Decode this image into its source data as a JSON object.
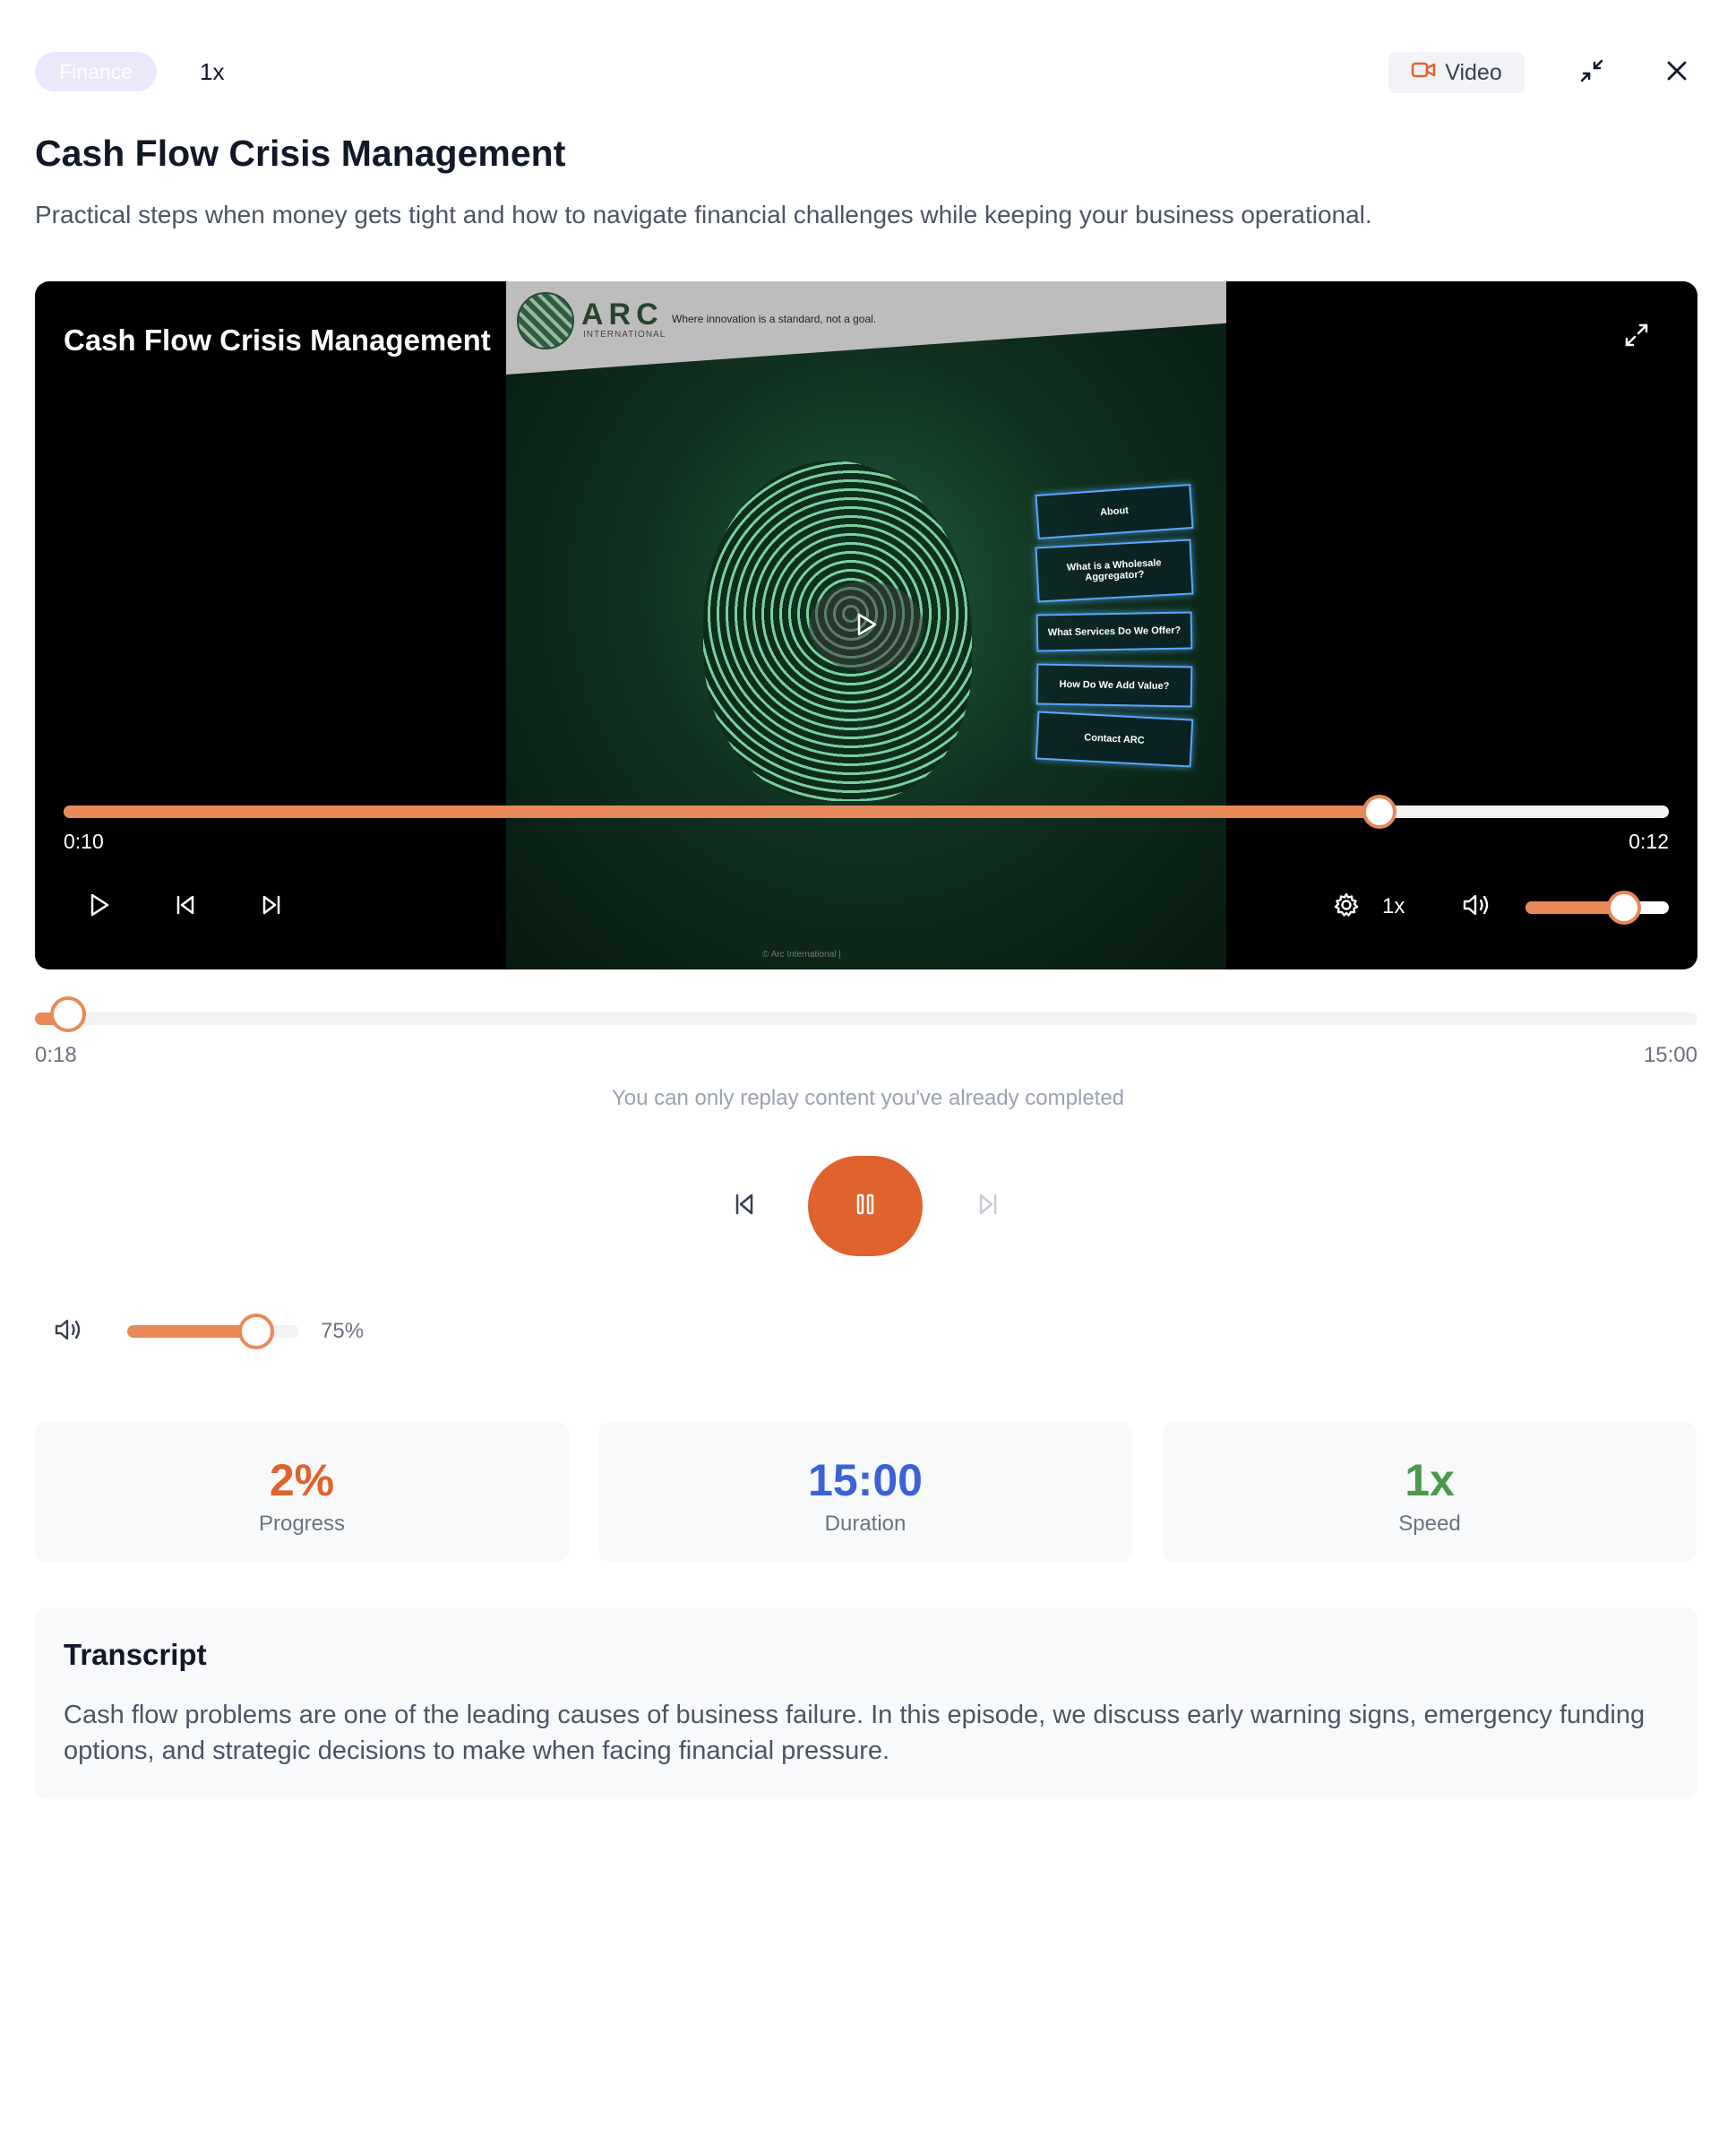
{
  "header": {
    "category_tag": "Finance",
    "speed": "1x",
    "video_toggle_label": "Video",
    "colors": {
      "accent": "#e0622d",
      "tag_bg": "#ede7fb"
    }
  },
  "episode": {
    "title": "Cash Flow Crisis Management",
    "description": "Practical steps when money gets tight and how to navigate financial challenges while keeping your business operational."
  },
  "video_player": {
    "title": "Cash Flow Crisis Management",
    "current_time": "0:10",
    "duration": "0:12",
    "progress_fraction": 0.82,
    "speed": "1x",
    "volume_fraction": 0.69,
    "icons": [
      "fullscreen-icon",
      "play-icon",
      "skip-back-icon",
      "skip-forward-icon",
      "settings-icon",
      "volume-icon"
    ],
    "frame": {
      "brand": "ARC",
      "brand_sub": "INTERNATIONAL",
      "tagline": "Where innovation is a standard, not a goal.",
      "menu": [
        "About",
        "What is a Wholesale Aggregator?",
        "What Services Do We Offer?",
        "How Do We Add Value?",
        "Contact ARC"
      ],
      "footer": "© Arc International |"
    }
  },
  "episode_player": {
    "current_time": "0:18",
    "duration": "15:00",
    "progress_fraction": 0.02,
    "replay_note": "You can only replay content you've already completed",
    "volume_percent_label": "75%",
    "volume_fraction": 0.75
  },
  "stats": [
    {
      "value": "2%",
      "label": "Progress",
      "color": "#e0622d"
    },
    {
      "value": "15:00",
      "label": "Duration",
      "color": "#3b63d6"
    },
    {
      "value": "1x",
      "label": "Speed",
      "color": "#4a9a4a"
    }
  ],
  "transcript": {
    "title": "Transcript",
    "text": "Cash flow problems are one of the leading causes of business failure. In this episode, we discuss early warning signs, emergency funding options, and strategic decisions to make when facing financial pressure."
  }
}
